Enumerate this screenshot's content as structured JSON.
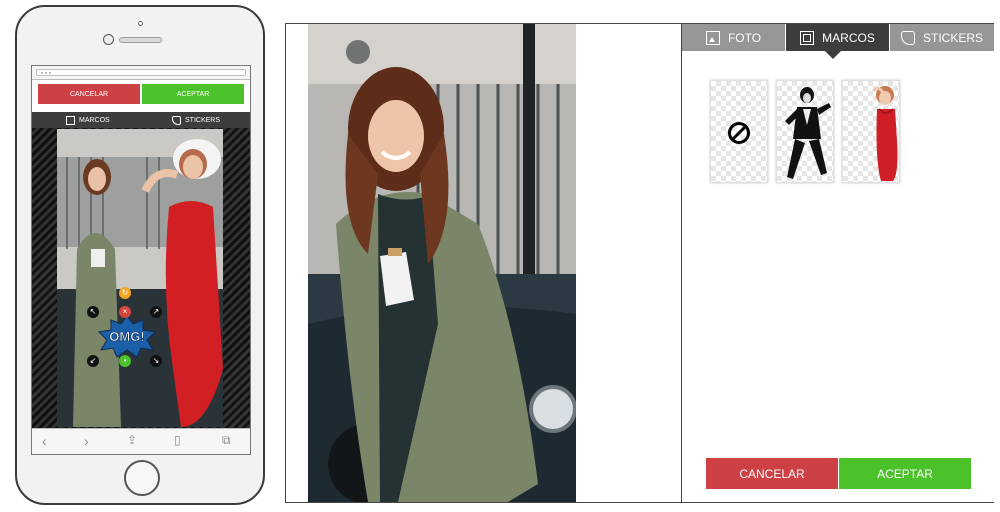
{
  "phone": {
    "cancel_label": "CANCELAR",
    "accept_label": "ACEPTAR",
    "tabs": [
      {
        "label": "MARCOS",
        "icon": "frame-icon"
      },
      {
        "label": "STICKERS",
        "icon": "sticker-icon"
      }
    ],
    "sticker_text": "OMG!",
    "safari_icons": [
      "back-icon",
      "forward-icon",
      "share-icon",
      "bookmarks-icon",
      "tabs-icon"
    ]
  },
  "editor": {
    "tabs": [
      {
        "label": "FOTO",
        "icon": "photo-icon",
        "active": false
      },
      {
        "label": "MARCOS",
        "icon": "frame-icon",
        "active": true
      },
      {
        "label": "STICKERS",
        "icon": "sticker-icon",
        "active": false
      }
    ],
    "thumbnails": [
      "no-frame-icon",
      "dancing-man-frame",
      "red-dress-woman-frame"
    ],
    "cancel_label": "CANCELAR",
    "accept_label": "ACEPTAR"
  },
  "colors": {
    "cancel": "#cd4145",
    "accept": "#4bc12a",
    "tab_active": "#3d3d3d",
    "tab_inactive": "#969696"
  }
}
